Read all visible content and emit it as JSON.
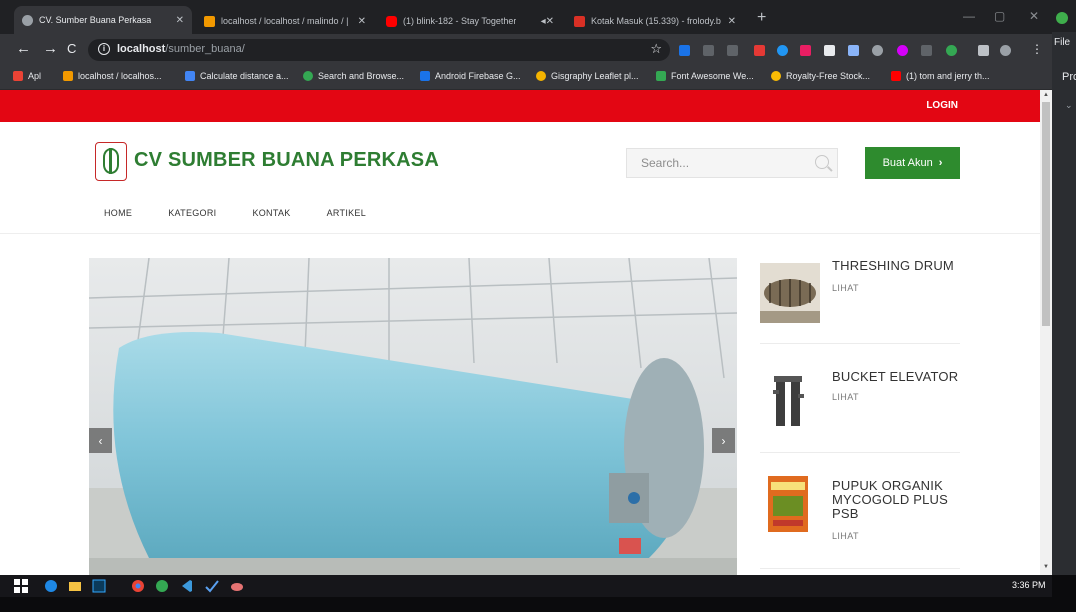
{
  "browser": {
    "tabs": [
      {
        "label": "CV. Sumber Buana Perkasa",
        "active": true,
        "color": "#9aa0a6"
      },
      {
        "label": "localhost / localhost / malindo / |",
        "active": false,
        "color": "#f29900"
      },
      {
        "label": "(1) blink-182 - Stay Together",
        "active": false,
        "color": "#ff0000"
      },
      {
        "label": "Kotak Masuk (15.339) - frolody.b",
        "active": false,
        "color": "#d93025"
      }
    ],
    "new_tab": "+",
    "url_host": "localhost",
    "url_path": "/sumber_buana/",
    "bookmarks": [
      {
        "label": "Apl",
        "color": "#ea4335"
      },
      {
        "label": "localhost / localhos...",
        "color": "#f29900"
      },
      {
        "label": "Calculate distance a...",
        "color": "#4285f4"
      },
      {
        "label": "Search and Browse...",
        "color": "#34a853"
      },
      {
        "label": "Android Firebase G...",
        "color": "#1a73e8"
      },
      {
        "label": "Gisgraphy Leaflet pl...",
        "color": "#f4b400"
      },
      {
        "label": "Font Awesome We...",
        "color": "#34a853"
      },
      {
        "label": "Royalty-Free Stock...",
        "color": "#fbbc04"
      },
      {
        "label": "(1) tom and jerry th...",
        "color": "#ff0000"
      }
    ]
  },
  "side_window": {
    "menu_file": "File",
    "heading": "Pro"
  },
  "site": {
    "login": "LOGIN",
    "brand": "CV SUMBER BUANA PERKASA",
    "search_placeholder": "Search...",
    "create_account": "Buat Akun",
    "create_chevron": "›",
    "nav": [
      "HOME",
      "KATEGORI",
      "KONTAK",
      "ARTIKEL"
    ],
    "slider_prev": "‹",
    "slider_next": "›",
    "products": [
      {
        "title": "THRESHING DRUM",
        "link": "LIHAT"
      },
      {
        "title": "BUCKET ELEVATOR",
        "link": "LIHAT"
      },
      {
        "title": "PUPUK ORGANIK MYCOGOLD PLUS PSB",
        "link": "LIHAT"
      }
    ],
    "colors": {
      "topbar": "#e30613",
      "brand": "#2e7d32",
      "button": "#2e8b2e"
    }
  },
  "taskbar": {
    "clock": "3:36 PM"
  }
}
